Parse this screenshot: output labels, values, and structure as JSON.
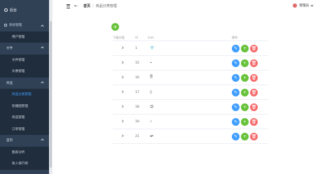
{
  "sidebar": {
    "brand": "后台",
    "groups": [
      {
        "label": "系统管理",
        "items": [
          "用户管理"
        ]
      },
      {
        "label": "文件",
        "items": [
          "文件管理",
          "头像管理"
        ]
      },
      {
        "label": "商品",
        "items": [
          "商品分类管理",
          "轮播图管理",
          "商品管理",
          "订单管理"
        ]
      },
      {
        "label": "首页",
        "items": [
          "图表分析",
          "收入排行榜"
        ]
      }
    ]
  },
  "header": {
    "breadcrumb_home": "首页",
    "breadcrumb_sep": "/",
    "breadcrumb_current": "商品分类管理",
    "username": "管理员"
  },
  "main": {
    "add_label": "+",
    "columns": [
      "下级分类",
      "id",
      "icon",
      "操作"
    ],
    "rows": [
      {
        "id": "1",
        "icon": "👕"
      },
      {
        "id": "15",
        "icon": "⌁"
      },
      {
        "id": "16",
        "icon": "🗎"
      },
      {
        "id": "17",
        "icon": "▯"
      },
      {
        "id": "18",
        "icon": "☺"
      },
      {
        "id": "19",
        "icon": "☝"
      },
      {
        "id": "21",
        "icon": "◂•"
      }
    ],
    "op_edit": "✎",
    "op_add": "+",
    "op_delete": "🗑"
  }
}
